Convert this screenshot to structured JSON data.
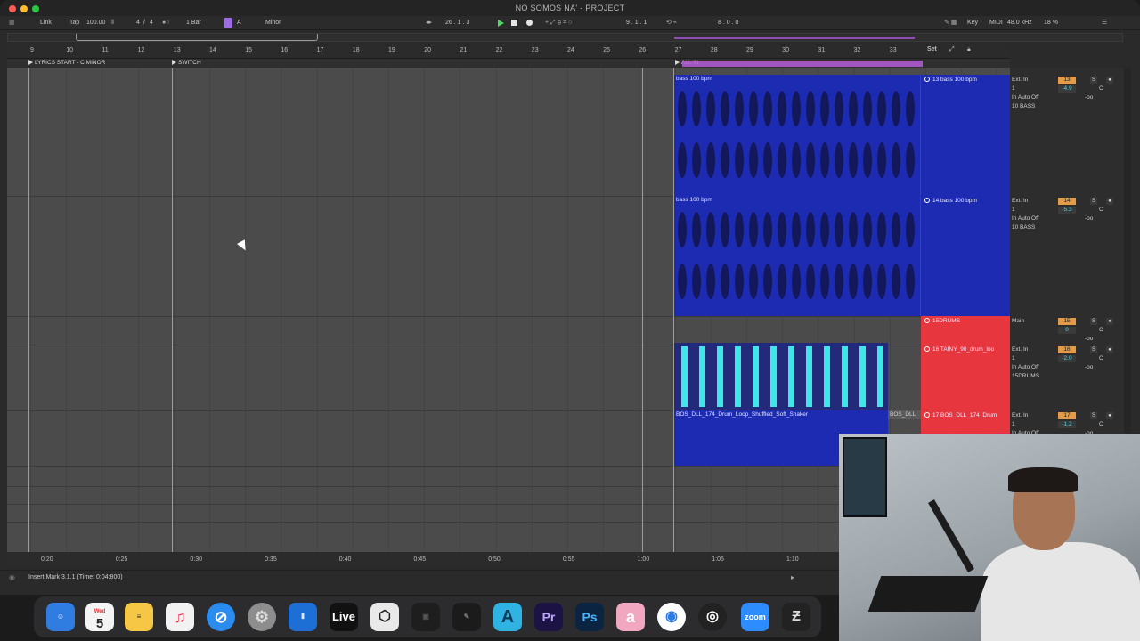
{
  "window": {
    "title": "NO SOMOS NA' - PROJECT"
  },
  "control_bar": {
    "link": "Link",
    "tap": "Tap",
    "tempo": "100.00",
    "time_sig_num": "4",
    "time_sig_sep": "/",
    "time_sig_den": "4",
    "quantize": "1 Bar",
    "key_letter": "A",
    "scale": "Minor",
    "position": "26 .  1 .  3",
    "loop_start": "9 .  1 .  1",
    "loop_length": "8 .  0 .  0",
    "key_label": "Key",
    "midi_label": "MIDI",
    "sample_rate": "48.0 kHz",
    "cpu": "18 %"
  },
  "ruler": {
    "bars": [
      "9",
      "10",
      "11",
      "12",
      "13",
      "14",
      "15",
      "16",
      "17",
      "18",
      "19",
      "20",
      "21",
      "22",
      "23",
      "24",
      "25",
      "26",
      "27",
      "28",
      "29",
      "30",
      "31",
      "32",
      "33"
    ],
    "set_label": "Set"
  },
  "locators": [
    {
      "label": "LYRICS START - C MINOR"
    },
    {
      "label": "SWITCH"
    },
    {
      "label": "ALL IN"
    }
  ],
  "arrangement_clips": [
    {
      "name": "bass 100 bpm",
      "color": "#1d2bb3"
    },
    {
      "name": "bass 100 bpm",
      "color": "#1d2bb3"
    },
    {
      "name": "BOS_DLL_174_Drum_Loop_Shuffled_Soft_Shaker",
      "color": "#1d2bb3"
    },
    {
      "name": "BOS_DLL",
      "color": "#5a5a5a"
    }
  ],
  "session_slots": [
    {
      "name": "13 bass 100 bpm",
      "color": "#1d2bb3"
    },
    {
      "name": "14 bass 100 bpm",
      "color": "#1d2bb3"
    },
    {
      "name": "15DRUMS",
      "color": "#e8363f"
    },
    {
      "name": "16 TAINY_90_drum_loo",
      "color": "#e8363f"
    },
    {
      "name": "17 BOS_DLL_174_Drum",
      "color": "#e8363f"
    }
  ],
  "mixer": [
    {
      "input": "Ext. In",
      "channel": "1",
      "monitor": "In  Auto  Off",
      "output": "10 BASS",
      "number": "13",
      "volume": "-4.9",
      "pan": "C",
      "sends": "-oo",
      "solo": "S"
    },
    {
      "input": "Ext. In",
      "channel": "1",
      "monitor": "In  Auto  Off",
      "output": "10 BASS",
      "number": "14",
      "volume": "-5.3",
      "pan": "C",
      "sends": "-oo",
      "solo": "S"
    },
    {
      "input": "Main",
      "channel": "",
      "monitor": "",
      "output": "",
      "number": "15",
      "volume": "0",
      "pan": "C",
      "sends": "-oo",
      "solo": "S"
    },
    {
      "input": "Ext. In",
      "channel": "1",
      "monitor": "In  Auto  Off",
      "output": "15DRUMS",
      "number": "16",
      "volume": "-2.0",
      "pan": "C",
      "sends": "-oo",
      "solo": "S"
    },
    {
      "input": "Ext. In",
      "channel": "1",
      "monitor": "In  Auto  Off",
      "output": "",
      "number": "17",
      "volume": "-1.2",
      "pan": "C",
      "sends": "-oo",
      "solo": "S"
    }
  ],
  "time_ruler": [
    "0:20",
    "0:25",
    "0:30",
    "0:35",
    "0:40",
    "0:45",
    "0:50",
    "0:55",
    "1:00",
    "1:05",
    "1:10"
  ],
  "status": {
    "text": "Insert Mark 3.1.1 (Time: 0:04:800)"
  },
  "dock": {
    "date": "5",
    "day": "Wed",
    "live_label": "Live",
    "zoom_label": "zoom",
    "ps_label": "Ps",
    "pr_label": "Pr"
  }
}
